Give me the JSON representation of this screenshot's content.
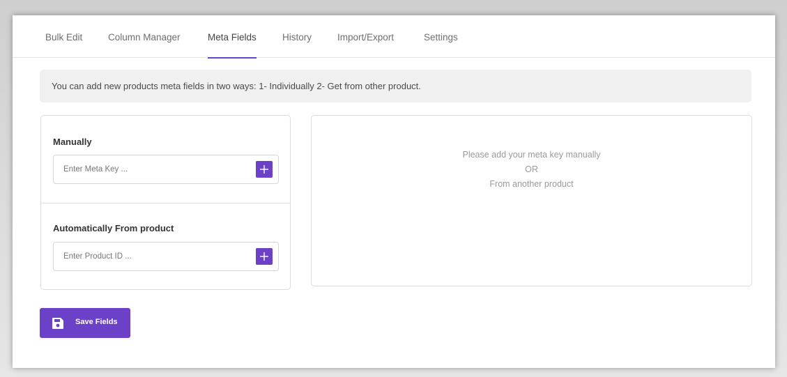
{
  "tabs": [
    {
      "label": "Bulk Edit"
    },
    {
      "label": "Column Manager"
    },
    {
      "label": "Meta Fields",
      "active": true
    },
    {
      "label": "History"
    },
    {
      "label": "Import/Export"
    },
    {
      "label": "Settings"
    }
  ],
  "info": {
    "text": "You can add new products meta fields in two ways: 1- Individually 2- Get from other product."
  },
  "manual": {
    "title": "Manually",
    "placeholder": "Enter Meta Key ..."
  },
  "automatic": {
    "title": "Automatically From product",
    "placeholder": "Enter Product ID ..."
  },
  "preview": {
    "line1": "Please add your meta key manually",
    "line2": "OR",
    "line3": "From another product"
  },
  "save_button": {
    "label": "Save Fields",
    "icon": "floppy-disk-icon"
  },
  "colors": {
    "accent": "#6a41c7",
    "info_bg": "#f0f0f0"
  }
}
